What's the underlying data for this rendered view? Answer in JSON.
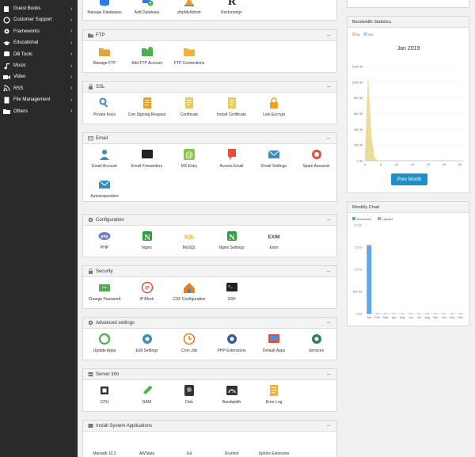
{
  "sidebar": {
    "items": [
      {
        "label": "Guest Books",
        "icon": "book-icon"
      },
      {
        "label": "Customer Support",
        "icon": "support-icon"
      },
      {
        "label": "Frameworks",
        "icon": "framework-icon"
      },
      {
        "label": "Educational",
        "icon": "graduation-cap-icon"
      },
      {
        "label": "DB Tools",
        "icon": "database-icon"
      },
      {
        "label": "Music",
        "icon": "music-icon"
      },
      {
        "label": "Video",
        "icon": "video-icon"
      },
      {
        "label": "RSS",
        "icon": "rss-icon"
      },
      {
        "label": "File Management",
        "icon": "file-icon"
      },
      {
        "label": "Others",
        "icon": "folder-icon"
      }
    ]
  },
  "top_tiles": [
    {
      "label": "Manage Databases",
      "icon": "database-icon"
    },
    {
      "label": "Add Database",
      "icon": "add-database-icon"
    },
    {
      "label": "phpMyAdmin",
      "icon": "phpmyadmin-icon"
    },
    {
      "label": "Rockmongo",
      "icon": "rockmongo-icon"
    }
  ],
  "sections": [
    {
      "title": "FTP",
      "icon": "folder-icon",
      "tiles": [
        {
          "label": "Manage FTP",
          "icon": "manage-ftp-icon"
        },
        {
          "label": "Add FTP Account",
          "icon": "add-ftp-icon"
        },
        {
          "label": "FTP Connections",
          "icon": "ftp-connections-icon"
        }
      ]
    },
    {
      "title": "SSL",
      "icon": "lock-icon",
      "tiles": [
        {
          "label": "Private Keys",
          "icon": "private-keys-icon"
        },
        {
          "label": "Cert Signing Request",
          "icon": "csr-icon"
        },
        {
          "label": "Certificate",
          "icon": "certificate-icon"
        },
        {
          "label": "Install Certificate",
          "icon": "install-certificate-icon"
        },
        {
          "label": "Lets Encrypt",
          "icon": "lets-encrypt-icon"
        }
      ]
    },
    {
      "title": "Email",
      "icon": "envelope-icon",
      "tiles": [
        {
          "label": "Email Account",
          "icon": "email-account-icon"
        },
        {
          "label": "Email Forwarders",
          "icon": "email-forwarders-icon"
        },
        {
          "label": "MX Entry",
          "icon": "mx-entry-icon"
        },
        {
          "label": "Access Email",
          "icon": "access-email-icon"
        },
        {
          "label": "Email Settings",
          "icon": "email-settings-icon"
        },
        {
          "label": "Spam Assassin",
          "icon": "spam-assassin-icon"
        },
        {
          "label": "Autoresponders",
          "icon": "autoresponders-icon"
        }
      ]
    },
    {
      "title": "Configuration",
      "icon": "gear-icon",
      "tiles": [
        {
          "label": "PHP",
          "icon": "php-icon"
        },
        {
          "label": "Nginx",
          "icon": "nginx-icon"
        },
        {
          "label": "MySQL",
          "icon": "mysql-icon"
        },
        {
          "label": "Nginx Settings",
          "icon": "nginx-settings-icon"
        },
        {
          "label": "Exim",
          "icon": "exim-icon"
        }
      ]
    },
    {
      "title": "Security",
      "icon": "lock-icon",
      "tiles": [
        {
          "label": "Change Password",
          "icon": "change-password-icon"
        },
        {
          "label": "IP Block",
          "icon": "ip-block-icon"
        },
        {
          "label": "CSF Configuration",
          "icon": "csf-icon"
        },
        {
          "label": "SSH",
          "icon": "terminal-icon"
        }
      ]
    },
    {
      "title": "Advanced settings",
      "icon": "gear-icon",
      "tiles": [
        {
          "label": "Update Apps",
          "icon": "update-apps-icon"
        },
        {
          "label": "Edit Settings",
          "icon": "edit-settings-icon"
        },
        {
          "label": "Cron Job",
          "icon": "cron-job-icon"
        },
        {
          "label": "PHP Extensions",
          "icon": "php-extensions-icon"
        },
        {
          "label": "Default Apps",
          "icon": "default-apps-icon"
        },
        {
          "label": "Services",
          "icon": "services-icon"
        }
      ]
    },
    {
      "title": "Server Info",
      "icon": "server-icon",
      "tiles": [
        {
          "label": "CPU",
          "icon": "cpu-icon"
        },
        {
          "label": "RAM",
          "icon": "ram-icon"
        },
        {
          "label": "Disk",
          "icon": "disk-icon"
        },
        {
          "label": "Bandwidth",
          "icon": "bandwidth-icon"
        },
        {
          "label": "Error Log",
          "icon": "error-log-icon"
        }
      ]
    },
    {
      "title": "Install System Applications",
      "icon": "box-icon",
      "tiles": [
        {
          "label": "Mariadb 10.3",
          "icon": "mariadb-icon"
        },
        {
          "label": "AWStats",
          "icon": "awstats-icon"
        },
        {
          "label": "Git",
          "icon": "git-icon"
        },
        {
          "label": "Drunkot",
          "icon": "app-icon"
        },
        {
          "label": "Sphinx Extension",
          "icon": "sphinx-icon"
        }
      ]
    }
  ],
  "bandwidth": {
    "title": "Bandwidth Statistics",
    "prev_button": "Prev Month",
    "chart_data": {
      "type": "area",
      "title": "Jan 2019",
      "legend": [
        "In",
        "Out"
      ],
      "legend_placement": "top-left",
      "x_ticks": [
        "0",
        "5",
        "10",
        "15",
        "20",
        "25",
        "30"
      ],
      "y_ticks": [
        "0 M",
        "200 M",
        "400 M",
        "600 M",
        "800 M",
        "1000 M",
        "1200 M"
      ],
      "ylim": [
        0,
        1200
      ],
      "xlim": [
        0,
        31
      ],
      "series": [
        {
          "name": "In",
          "color": "#e8d68a",
          "x": [
            0,
            1,
            2,
            3,
            4,
            5,
            31
          ],
          "values": [
            0,
            1050,
            300,
            40,
            5,
            0,
            0
          ]
        },
        {
          "name": "Out",
          "color": "#a8d4f0",
          "x": [
            0,
            1,
            2,
            31
          ],
          "values": [
            0,
            5,
            0,
            0
          ]
        }
      ]
    }
  },
  "monthly": {
    "title": "Monthly Chart",
    "chart_data": {
      "type": "bar",
      "legend": [
        "Download",
        "Upload"
      ],
      "legend_placement": "top-left",
      "categories": [
        "Jan",
        "Feb",
        "Mar",
        "Apr",
        "May",
        "Jun",
        "Jul",
        "Aug",
        "Sep",
        "Oct",
        "Nov",
        "Dec"
      ],
      "y_ticks": [
        "0 M",
        "500 M",
        "1.0 G",
        "1.5 G",
        "2.0 G"
      ],
      "ylim": [
        0,
        2000
      ],
      "series": [
        {
          "name": "Download",
          "color": "#5aa9e6",
          "values": [
            1520,
            0,
            0,
            0,
            0,
            0,
            0,
            0,
            0,
            0,
            0,
            0
          ]
        },
        {
          "name": "Upload",
          "color": "#d689d9",
          "values": [
            30,
            0,
            0,
            0,
            0,
            0,
            0,
            0,
            0,
            0,
            0,
            0
          ]
        }
      ]
    }
  }
}
